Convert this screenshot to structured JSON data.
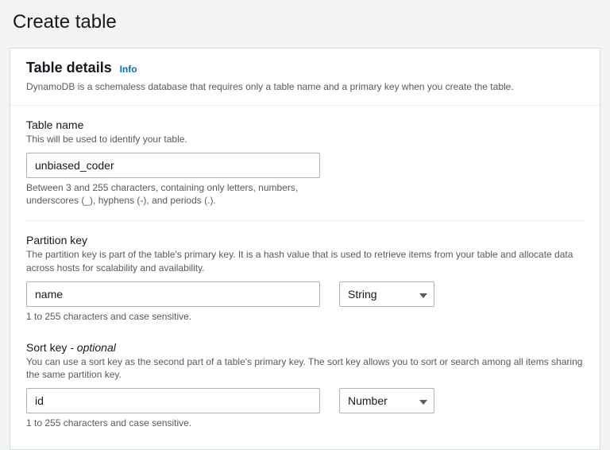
{
  "page": {
    "title": "Create table"
  },
  "details": {
    "heading": "Table details",
    "info_label": "Info",
    "description": "DynamoDB is a schemaless database that requires only a table name and a primary key when you create the table."
  },
  "table_name": {
    "label": "Table name",
    "description": "This will be used to identify your table.",
    "value": "unbiased_coder",
    "hint": "Between 3 and 255 characters, containing only letters, numbers, underscores (_), hyphens (-), and periods (.)."
  },
  "partition_key": {
    "label": "Partition key",
    "description": "The partition key is part of the table's primary key. It is a hash value that is used to retrieve items from your table and allocate data across hosts for scalability and availability.",
    "value": "name",
    "type_selected": "String",
    "hint": "1 to 255 characters and case sensitive."
  },
  "sort_key": {
    "label": "Sort key",
    "optional_suffix": " - optional",
    "description": "You can use a sort key as the second part of a table's primary key. The sort key allows you to sort or search among all items sharing the same partition key.",
    "value": "id",
    "type_selected": "Number",
    "hint": "1 to 255 characters and case sensitive."
  }
}
